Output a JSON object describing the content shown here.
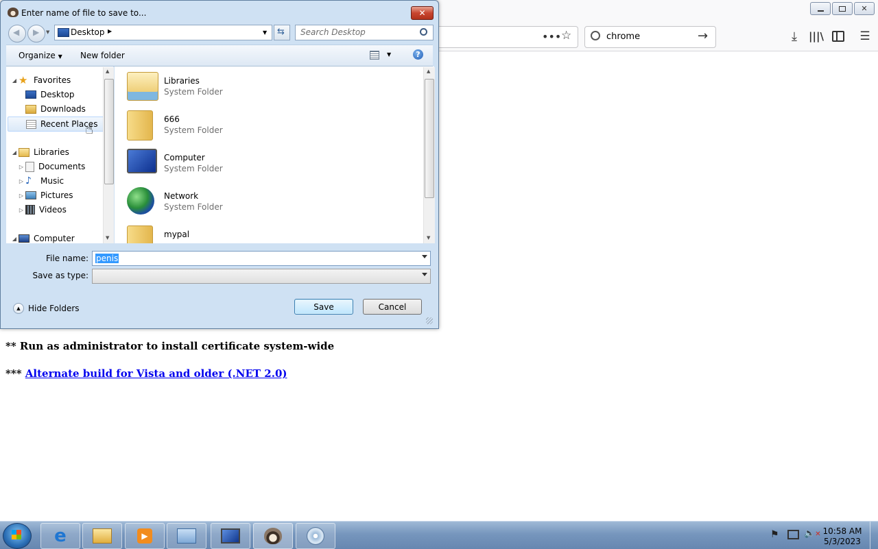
{
  "browser": {
    "search_value": "chrome",
    "page_lines": [
      "** Run as administrator to install certificate system-wide",
      "*** ",
      "Alternate build for Vista and older (.NET 2.0)"
    ]
  },
  "dialog": {
    "title": "Enter name of file to save to...",
    "address": "Desktop",
    "search_placeholder": "Search Desktop",
    "toolbar": {
      "organize": "Organize",
      "new_folder": "New folder"
    },
    "nav": {
      "favorites": "Favorites",
      "desktop": "Desktop",
      "downloads": "Downloads",
      "recent_places": "Recent Places",
      "libraries": "Libraries",
      "documents": "Documents",
      "music": "Music",
      "pictures": "Pictures",
      "videos": "Videos",
      "computer": "Computer"
    },
    "files": [
      {
        "name": "Libraries",
        "type": "System Folder"
      },
      {
        "name": "666",
        "type": "System Folder"
      },
      {
        "name": "Computer",
        "type": "System Folder"
      },
      {
        "name": "Network",
        "type": "System Folder"
      },
      {
        "name": "mypal",
        "type": ""
      }
    ],
    "file_name_label": "File name:",
    "file_name_value": "penis",
    "save_as_type_label": "Save as type:",
    "save_as_type_value": "",
    "hide_folders": "Hide Folders",
    "save": "Save",
    "cancel": "Cancel"
  },
  "taskbar": {
    "time": "10:58 AM",
    "date": "5/3/2023"
  }
}
